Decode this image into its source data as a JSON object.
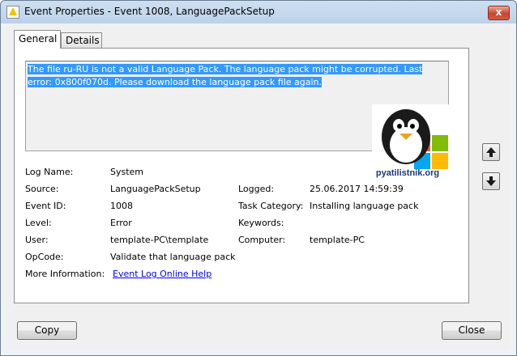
{
  "window": {
    "title": "Event Properties - Event 1008, LanguagePackSetup",
    "close_glyph": "x"
  },
  "tabs": [
    {
      "label": "General",
      "active": true
    },
    {
      "label": "Details",
      "active": false
    }
  ],
  "message": "The file ru-RU is not a valid Language Pack. The language pack might be corrupted. Last error: 0x800f070d. Please download the language pack file again.",
  "watermark": {
    "text": "pyatilistnik.org"
  },
  "fields": {
    "log_name": {
      "label": "Log Name:",
      "value": "System"
    },
    "source": {
      "label": "Source:",
      "value": "LanguagePackSetup"
    },
    "logged": {
      "label": "Logged:",
      "value": "25.06.2017 14:59:39"
    },
    "event_id": {
      "label": "Event ID:",
      "value": "1008"
    },
    "task_category": {
      "label": "Task Category:",
      "value": "Installing language pack"
    },
    "level": {
      "label": "Level:",
      "value": "Error"
    },
    "keywords": {
      "label": "Keywords:",
      "value": ""
    },
    "user": {
      "label": "User:",
      "value": "template-PC\\template"
    },
    "computer": {
      "label": "Computer:",
      "value": "template-PC"
    },
    "opcode": {
      "label": "OpCode:",
      "value": "Validate that language pack"
    },
    "more_info": {
      "label": "More Information:",
      "link": "Event Log Online Help"
    }
  },
  "buttons": {
    "copy": "Copy",
    "close": "Close"
  },
  "colors": {
    "selection": "#3399ff",
    "link": "#0000ee",
    "close_button": "#c8452d"
  }
}
